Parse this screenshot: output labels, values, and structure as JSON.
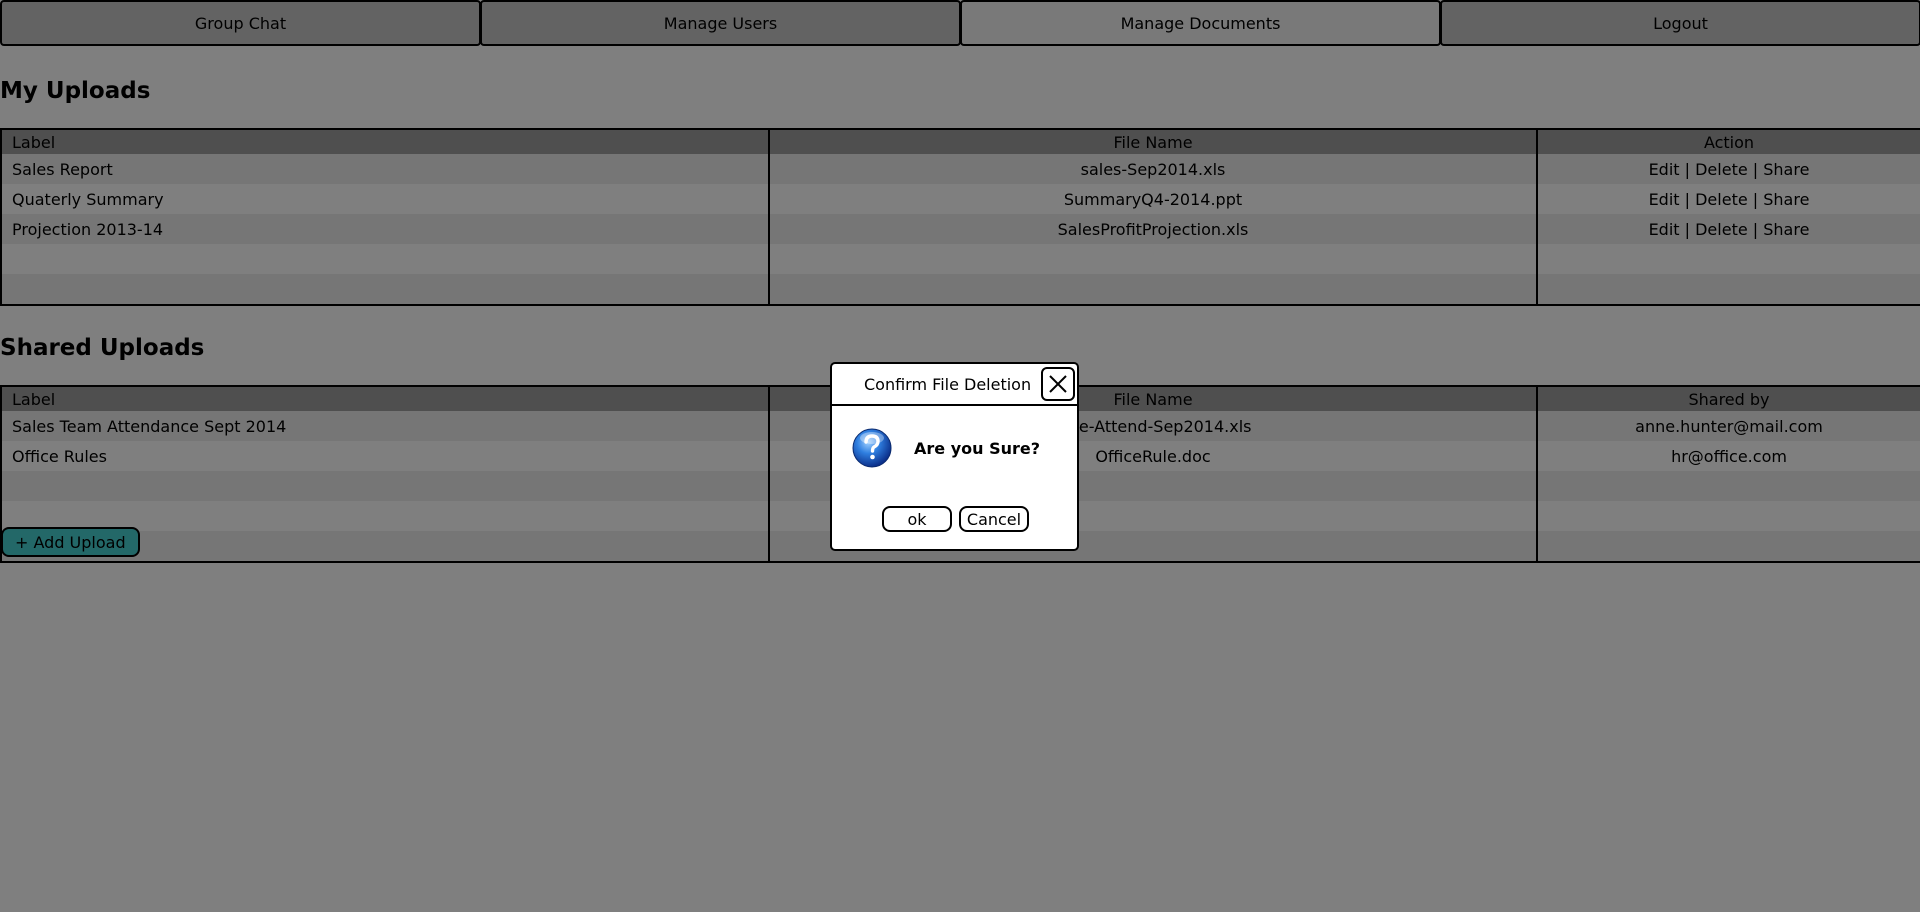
{
  "nav": {
    "items": [
      "Group Chat",
      "Manage Users",
      "Manage Documents",
      "Logout"
    ],
    "active": "Manage Documents"
  },
  "my_uploads": {
    "title": "My Uploads",
    "columns": [
      "Label",
      "File Name",
      "Action"
    ],
    "rows": [
      {
        "label": "Sales Report",
        "file": "sales-Sep2014.xls",
        "action": "Edit | Delete | Share"
      },
      {
        "label": "Quaterly Summary",
        "file": "SummaryQ4-2014.ppt",
        "action": "Edit | Delete | Share"
      },
      {
        "label": "Projection 2013-14",
        "file": "SalesProfitProjection.xls",
        "action": "Edit | Delete | Share"
      }
    ]
  },
  "shared_uploads": {
    "title": "Shared Uploads",
    "columns": [
      "Label",
      "File Name",
      "Shared by"
    ],
    "rows": [
      {
        "label": "Sales Team Attendance Sept 2014",
        "file": "Sale-Attend-Sep2014.xls",
        "shared_by": "anne.hunter@mail.com"
      },
      {
        "label": "Office Rules",
        "file": "OfficeRule.doc",
        "shared_by": "hr@office.com"
      }
    ]
  },
  "add_upload_label": "+ Add Upload",
  "dialog": {
    "title": "Confirm File Deletion",
    "message": "Are you Sure?",
    "ok_label": "ok",
    "cancel_label": "Cancel",
    "icon": "question-icon"
  },
  "colors": {
    "nav_bg": "#c7c7c7",
    "nav_active_bg": "#f2f2f2",
    "table_header_bg": "#9e9e9e",
    "row_alt_bg": "#ececec",
    "accent": "#46d1d1",
    "overlay": "rgba(0,0,0,0.5)"
  }
}
